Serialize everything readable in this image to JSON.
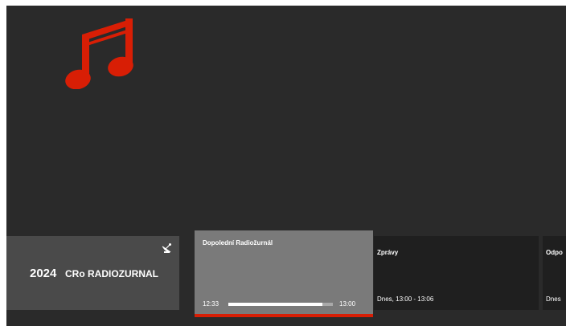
{
  "colors": {
    "background": "#2a2a2a",
    "accent": "#d81e05",
    "channel_card": "#4a4a4a",
    "current_card": "#7a7a7a",
    "next_card": "#1f1f1f"
  },
  "logo": {
    "icon": "music-note-icon"
  },
  "channel": {
    "number": "2024",
    "name": "CRo RADIOZURNAL",
    "icon": "satellite-dish-icon"
  },
  "current_program": {
    "title": "Dopolední Radiožurnál",
    "start": "12:33",
    "end": "13:00",
    "progress": 0.9
  },
  "upcoming": [
    {
      "title": "Zprávy",
      "time": "Dnes, 13:00 - 13:06"
    },
    {
      "title": "Odpo",
      "time": "Dnes"
    }
  ]
}
